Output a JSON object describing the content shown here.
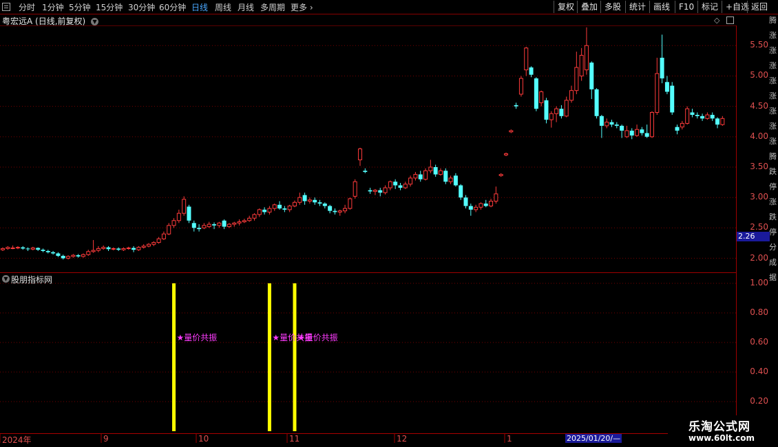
{
  "toolbar": {
    "periods": [
      "分时",
      "1分钟",
      "5分钟",
      "15分钟",
      "30分钟",
      "60分钟",
      "日线",
      "周线",
      "月线",
      "多周期",
      "更多"
    ],
    "active_period": "日线",
    "right_buttons": [
      "复权",
      "叠加",
      "多股",
      "统计",
      "画线",
      "F10",
      "标记",
      "+自选",
      "返回"
    ]
  },
  "stock": {
    "title": "粤宏远A (日线,前复权)"
  },
  "indicator": {
    "title": "股朋指标网",
    "signal_label": "★量价共振"
  },
  "current_price_label": "2.26",
  "current_date_label": "2025/01/20/—",
  "date_labels": [
    "2024年",
    "9",
    "10",
    "11",
    "12",
    "1"
  ],
  "watermark": {
    "line1": "乐淘公式网",
    "line2": "www.60lt.com"
  },
  "side_text": "腾涨涨涨涨涨涨涨涨腾跌停涨跌停分成据",
  "colors": {
    "up": "#ff3b3b",
    "down": "#54ffff",
    "signal": "#ffff00",
    "grid": "#7a0000",
    "label": "#ff3cff"
  },
  "chart_data": [
    {
      "type": "candlestick",
      "title": "粤宏远A (日线,前复权)",
      "y_ticks": [
        2.0,
        2.5,
        3.0,
        3.5,
        4.0,
        4.5,
        5.0,
        5.5
      ],
      "ylim": [
        1.78,
        5.82
      ],
      "series": [
        {
          "values": [
            [
              2.14,
              2.16,
              2.18,
              2.12
            ],
            [
              2.16,
              2.18,
              2.2,
              2.14
            ],
            [
              2.17,
              2.17,
              2.21,
              2.15
            ],
            [
              2.17,
              2.18,
              2.2,
              2.15
            ],
            [
              2.18,
              2.16,
              2.2,
              2.14
            ],
            [
              2.16,
              2.15,
              2.18,
              2.12
            ],
            [
              2.15,
              2.17,
              2.19,
              2.13
            ],
            [
              2.17,
              2.14,
              2.18,
              2.12
            ],
            [
              2.14,
              2.12,
              2.16,
              2.1
            ],
            [
              2.12,
              2.1,
              2.14,
              2.08
            ],
            [
              2.1,
              2.08,
              2.12,
              2.06
            ],
            [
              2.08,
              2.04,
              2.1,
              2.02
            ],
            [
              2.04,
              2.0,
              2.06,
              1.98
            ],
            [
              2.0,
              2.03,
              2.05,
              1.98
            ],
            [
              2.03,
              2.05,
              2.07,
              2.01
            ],
            [
              2.05,
              2.03,
              2.07,
              2.01
            ],
            [
              2.03,
              2.06,
              2.08,
              2.01
            ],
            [
              2.06,
              2.11,
              2.14,
              2.04
            ],
            [
              2.11,
              2.13,
              2.3,
              2.09
            ],
            [
              2.13,
              2.16,
              2.2,
              2.1
            ],
            [
              2.16,
              2.18,
              2.21,
              2.14
            ],
            [
              2.18,
              2.15,
              2.2,
              2.12
            ],
            [
              2.15,
              2.16,
              2.18,
              2.13
            ],
            [
              2.16,
              2.14,
              2.18,
              2.12
            ],
            [
              2.14,
              2.16,
              2.18,
              2.12
            ],
            [
              2.16,
              2.17,
              2.19,
              2.14
            ],
            [
              2.17,
              2.14,
              2.2,
              2.1
            ],
            [
              2.14,
              2.18,
              2.2,
              2.12
            ],
            [
              2.18,
              2.2,
              2.23,
              2.16
            ],
            [
              2.2,
              2.23,
              2.25,
              2.18
            ],
            [
              2.23,
              2.26,
              2.28,
              2.2
            ],
            [
              2.26,
              2.32,
              2.35,
              2.24
            ],
            [
              2.32,
              2.4,
              2.44,
              2.3
            ],
            [
              2.4,
              2.54,
              2.58,
              2.38
            ],
            [
              2.54,
              2.62,
              2.66,
              2.5
            ],
            [
              2.62,
              2.74,
              2.8,
              2.58
            ],
            [
              2.74,
              2.97,
              3.02,
              2.7
            ],
            [
              2.85,
              2.62,
              2.88,
              2.58
            ],
            [
              2.58,
              2.5,
              2.62,
              2.44
            ],
            [
              2.5,
              2.48,
              2.56,
              2.44
            ],
            [
              2.5,
              2.54,
              2.58,
              2.48
            ],
            [
              2.52,
              2.56,
              2.6,
              2.5
            ],
            [
              2.56,
              2.54,
              2.59,
              2.48
            ],
            [
              2.54,
              2.58,
              2.6,
              2.5
            ],
            [
              2.62,
              2.52,
              2.64,
              2.48
            ],
            [
              2.52,
              2.56,
              2.58,
              2.5
            ],
            [
              2.56,
              2.58,
              2.6,
              2.52
            ],
            [
              2.58,
              2.6,
              2.64,
              2.54
            ],
            [
              2.6,
              2.62,
              2.65,
              2.58
            ],
            [
              2.62,
              2.66,
              2.7,
              2.6
            ],
            [
              2.66,
              2.72,
              2.74,
              2.62
            ],
            [
              2.72,
              2.8,
              2.82,
              2.68
            ],
            [
              2.8,
              2.76,
              2.84,
              2.72
            ],
            [
              2.76,
              2.82,
              2.86,
              2.72
            ],
            [
              2.82,
              2.88,
              2.9,
              2.78
            ],
            [
              2.88,
              2.82,
              2.94,
              2.8
            ],
            [
              2.82,
              2.8,
              2.86,
              2.76
            ],
            [
              2.8,
              2.86,
              2.88,
              2.76
            ],
            [
              2.86,
              2.92,
              2.95,
              2.84
            ],
            [
              2.92,
              3.0,
              3.08,
              2.88
            ],
            [
              3.04,
              2.94,
              3.08,
              2.88
            ],
            [
              2.94,
              2.96,
              3.0,
              2.9
            ],
            [
              2.96,
              2.92,
              3.0,
              2.88
            ],
            [
              2.92,
              2.9,
              2.96,
              2.86
            ],
            [
              2.9,
              2.86,
              2.92,
              2.82
            ],
            [
              2.86,
              2.78,
              2.88,
              2.74
            ],
            [
              2.78,
              2.76,
              2.82,
              2.72
            ],
            [
              2.76,
              2.78,
              2.8,
              2.7
            ],
            [
              2.78,
              2.82,
              2.88,
              2.74
            ],
            [
              2.82,
              2.98,
              3.0,
              2.8
            ],
            [
              3.02,
              3.26,
              3.3,
              2.98
            ],
            [
              3.62,
              3.8,
              3.82,
              3.52
            ],
            [
              3.44,
              3.42,
              3.48,
              3.4
            ],
            [
              3.12,
              3.1,
              3.16,
              3.06
            ],
            [
              3.1,
              3.12,
              3.14,
              3.04
            ],
            [
              3.12,
              3.08,
              3.16,
              3.02
            ],
            [
              3.08,
              3.16,
              3.2,
              3.05
            ],
            [
              3.16,
              3.26,
              3.28,
              3.12
            ],
            [
              3.26,
              3.2,
              3.3,
              3.14
            ],
            [
              3.2,
              3.16,
              3.24,
              3.12
            ],
            [
              3.16,
              3.22,
              3.26,
              3.14
            ],
            [
              3.22,
              3.32,
              3.36,
              3.18
            ],
            [
              3.32,
              3.38,
              3.42,
              3.28
            ],
            [
              3.38,
              3.3,
              3.44,
              3.26
            ],
            [
              3.3,
              3.44,
              3.48,
              3.28
            ],
            [
              3.44,
              3.5,
              3.62,
              3.4
            ],
            [
              3.5,
              3.38,
              3.54,
              3.34
            ],
            [
              3.38,
              3.44,
              3.48,
              3.36
            ],
            [
              3.44,
              3.26,
              3.48,
              3.22
            ],
            [
              3.26,
              3.32,
              3.36,
              3.22
            ],
            [
              3.36,
              3.2,
              3.4,
              3.18
            ],
            [
              3.2,
              3.0,
              3.22,
              2.96
            ],
            [
              3.0,
              2.86,
              3.04,
              2.82
            ],
            [
              2.86,
              2.8,
              2.9,
              2.7
            ],
            [
              2.8,
              2.84,
              2.88,
              2.76
            ],
            [
              2.84,
              2.9,
              2.92,
              2.8
            ],
            [
              2.9,
              2.86,
              2.96,
              2.84
            ],
            [
              2.86,
              2.94,
              2.98,
              2.84
            ],
            [
              2.94,
              3.06,
              3.18,
              2.9
            ],
            [
              3.36,
              3.38,
              3.4,
              3.34
            ],
            [
              3.7,
              3.72,
              3.74,
              3.68
            ],
            [
              4.08,
              4.1,
              4.12,
              4.06
            ],
            [
              4.52,
              4.5,
              4.56,
              4.46
            ],
            [
              4.7,
              4.96,
              5.0,
              4.66
            ],
            [
              5.1,
              5.46,
              5.48,
              5.0
            ],
            [
              5.14,
              5.02,
              5.16,
              4.98
            ],
            [
              4.96,
              4.46,
              4.98,
              4.42
            ],
            [
              4.56,
              4.74,
              4.76,
              4.5
            ],
            [
              4.6,
              4.28,
              4.64,
              4.22
            ],
            [
              4.28,
              4.38,
              4.42,
              4.15
            ],
            [
              4.38,
              4.46,
              4.5,
              4.24
            ],
            [
              4.46,
              4.34,
              4.52,
              4.3
            ],
            [
              4.34,
              4.6,
              4.66,
              4.32
            ],
            [
              4.6,
              4.76,
              4.84,
              4.56
            ],
            [
              4.76,
              5.14,
              5.4,
              4.7
            ],
            [
              5.0,
              5.34,
              5.46,
              4.92
            ],
            [
              5.1,
              5.5,
              5.8,
              5.02
            ],
            [
              5.22,
              4.78,
              5.24,
              4.62
            ],
            [
              4.78,
              4.34,
              4.8,
              4.3
            ],
            [
              4.34,
              4.18,
              4.36,
              3.98
            ],
            [
              4.18,
              4.24,
              4.3,
              4.14
            ],
            [
              4.24,
              4.2,
              4.28,
              4.16
            ],
            [
              4.2,
              4.18,
              4.24,
              4.14
            ],
            [
              4.18,
              4.1,
              4.2,
              3.98
            ],
            [
              4.0,
              4.1,
              4.18,
              3.98
            ],
            [
              4.1,
              4.02,
              4.14,
              3.96
            ],
            [
              4.02,
              4.12,
              4.2,
              4.0
            ],
            [
              4.12,
              4.06,
              4.16,
              4.02
            ],
            [
              4.06,
              4.0,
              4.2,
              3.98
            ],
            [
              4.0,
              4.4,
              4.42,
              3.98
            ],
            [
              4.4,
              5.04,
              5.3,
              4.36
            ],
            [
              5.3,
              4.96,
              5.68,
              4.88
            ],
            [
              4.9,
              4.74,
              5.0,
              4.7
            ],
            [
              4.84,
              4.4,
              4.9,
              4.36
            ],
            [
              4.16,
              4.1,
              4.2,
              4.04
            ],
            [
              4.16,
              4.22,
              4.26,
              4.12
            ],
            [
              4.22,
              4.46,
              4.5,
              4.2
            ],
            [
              4.4,
              4.36,
              4.46,
              4.32
            ],
            [
              4.36,
              4.34,
              4.4,
              4.3
            ],
            [
              4.34,
              4.3,
              4.38,
              4.26
            ],
            [
              4.3,
              4.36,
              4.4,
              4.28
            ],
            [
              4.36,
              4.3,
              4.4,
              4.26
            ],
            [
              4.3,
              4.2,
              4.32,
              4.14
            ],
            [
              4.2,
              4.3,
              4.34,
              4.18
            ]
          ]
        }
      ]
    },
    {
      "type": "bar",
      "title": "股朋指标网",
      "y_ticks": [
        0.2,
        0.4,
        0.6,
        0.8,
        1.0
      ],
      "ylim": [
        0.0,
        1.0
      ],
      "signals": [
        {
          "index": 34,
          "value": 1.0,
          "label": "★量价共振"
        },
        {
          "index": 53,
          "value": 1.0,
          "label": "★量价共振"
        },
        {
          "index": 58,
          "value": 1.0,
          "label": "★量价共振"
        }
      ]
    }
  ]
}
